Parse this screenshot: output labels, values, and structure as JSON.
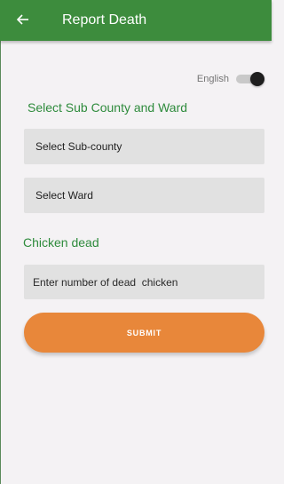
{
  "app_bar": {
    "title": "Report Death",
    "back_icon": "arrow-left-icon",
    "background": "#3d8c3d"
  },
  "language": {
    "label": "English",
    "toggle_on": false
  },
  "location_section": {
    "heading": "Select Sub County and Ward",
    "subcounty_select": {
      "value": "Select Sub-county"
    },
    "ward_select": {
      "value": "Select Ward"
    }
  },
  "chicken_section": {
    "heading": "Chicken dead",
    "count_input": {
      "placeholder": "Enter number of dead  chicken",
      "value": ""
    }
  },
  "submit": {
    "label": "SUBMIT",
    "color": "#e8873a"
  },
  "colors": {
    "heading": "#2e8b3c",
    "field_background": "#e1e1e1",
    "page_background": "#f4f2f4"
  }
}
